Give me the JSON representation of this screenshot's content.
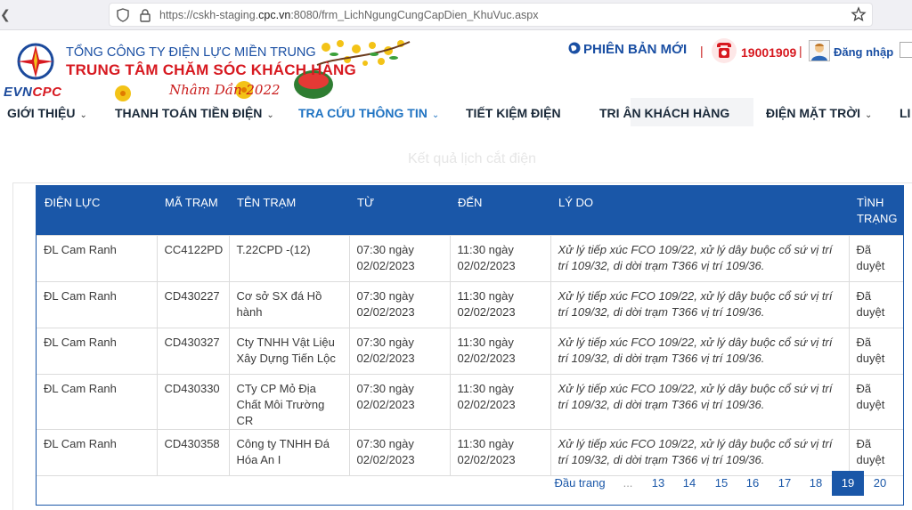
{
  "browser": {
    "url_prefix": "https://cskh-staging.",
    "url_host": "cpc.vn",
    "url_suffix": ":8080/frm_LichNgungCungCapDien_KhuVuc.aspx"
  },
  "header": {
    "brand_evn": "EVN",
    "brand_cpc": "CPC",
    "company": "TỔNG CÔNG TY ĐIỆN LỰC MIỀN TRUNG",
    "center_name": "TRUNG TÂM CHĂM SÓC KHÁCH HÀNG",
    "tet_text": "Nhâm Dần 2022",
    "new_version": "PHIÊN BẢN MỚI",
    "hotline": "19001909",
    "login": "Đăng nhập"
  },
  "nav": {
    "items": [
      {
        "label": "GIỚI THIỆU"
      },
      {
        "label": "THANH TOÁN TIỀN ĐIỆN"
      },
      {
        "label": "TRA CỨU THÔNG TIN"
      },
      {
        "label": "TIẾT KIỆM ĐIỆN"
      },
      {
        "label": "TRI ÂN KHÁCH HÀNG"
      },
      {
        "label": "ĐIỆN MẶT TRỜI"
      },
      {
        "label": "LI"
      }
    ]
  },
  "page": {
    "title": "Kết quả lịch cắt điện"
  },
  "table": {
    "headers": [
      "ĐIỆN LỰC",
      "MÃ TRẠM",
      "TÊN TRẠM",
      "TỪ",
      "ĐẾN",
      "LÝ DO",
      "TÌNH TRẠNG"
    ],
    "rows": [
      [
        "ĐL Cam Ranh",
        "CC4122PD",
        "T.22CPD -(12)",
        "07:30 ngày 02/02/2023",
        "11:30 ngày 02/02/2023",
        "Xử lý tiếp xúc FCO 109/22, xử lý dây buộc cổ sứ vị trí trí 109/32, di dời trạm T366 vị trí 109/36.",
        "Đã duyệt"
      ],
      [
        "ĐL Cam Ranh",
        "CD430227",
        "Cơ sở SX đá Hồ hành",
        "07:30 ngày 02/02/2023",
        "11:30 ngày 02/02/2023",
        "Xử lý tiếp xúc FCO 109/22, xử lý dây buộc cổ sứ vị trí trí 109/32, di dời trạm T366 vị trí 109/36.",
        "Đã duyệt"
      ],
      [
        "ĐL Cam Ranh",
        "CD430327",
        "Cty TNHH Vật Liệu Xây Dựng Tiến Lộc",
        "07:30 ngày 02/02/2023",
        "11:30 ngày 02/02/2023",
        "Xử lý tiếp xúc FCO 109/22, xử lý dây buộc cổ sứ vị trí trí 109/32, di dời trạm T366 vị trí 109/36.",
        "Đã duyệt"
      ],
      [
        "ĐL Cam Ranh",
        "CD430330",
        "CTy CP Mỏ Địa Chất Môi Trường CR",
        "07:30 ngày 02/02/2023",
        "11:30 ngày 02/02/2023",
        "Xử lý tiếp xúc FCO 109/22, xử lý dây buộc cổ sứ vị trí trí 109/32, di dời trạm T366 vị trí 109/36.",
        "Đã duyệt"
      ],
      [
        "ĐL Cam Ranh",
        "CD430358",
        "Công ty TNHH Đá Hóa An I",
        "07:30 ngày 02/02/2023",
        "11:30 ngày 02/02/2023",
        "Xử lý tiếp xúc FCO 109/22, xử lý dây buộc cổ sứ vị trí trí 109/32, di dời trạm T366 vị trí 109/36.",
        "Đã duyệt"
      ]
    ]
  },
  "pager": {
    "first": "Đầu trang",
    "dots": "...",
    "pages": [
      "13",
      "14",
      "15",
      "16",
      "17",
      "18",
      "19",
      "20"
    ],
    "current": "19"
  },
  "colors": {
    "table_header": "#1a57a8",
    "brand_red": "#d71920",
    "brand_blue": "#1a4fa3",
    "nav_active": "#1f73c2"
  }
}
